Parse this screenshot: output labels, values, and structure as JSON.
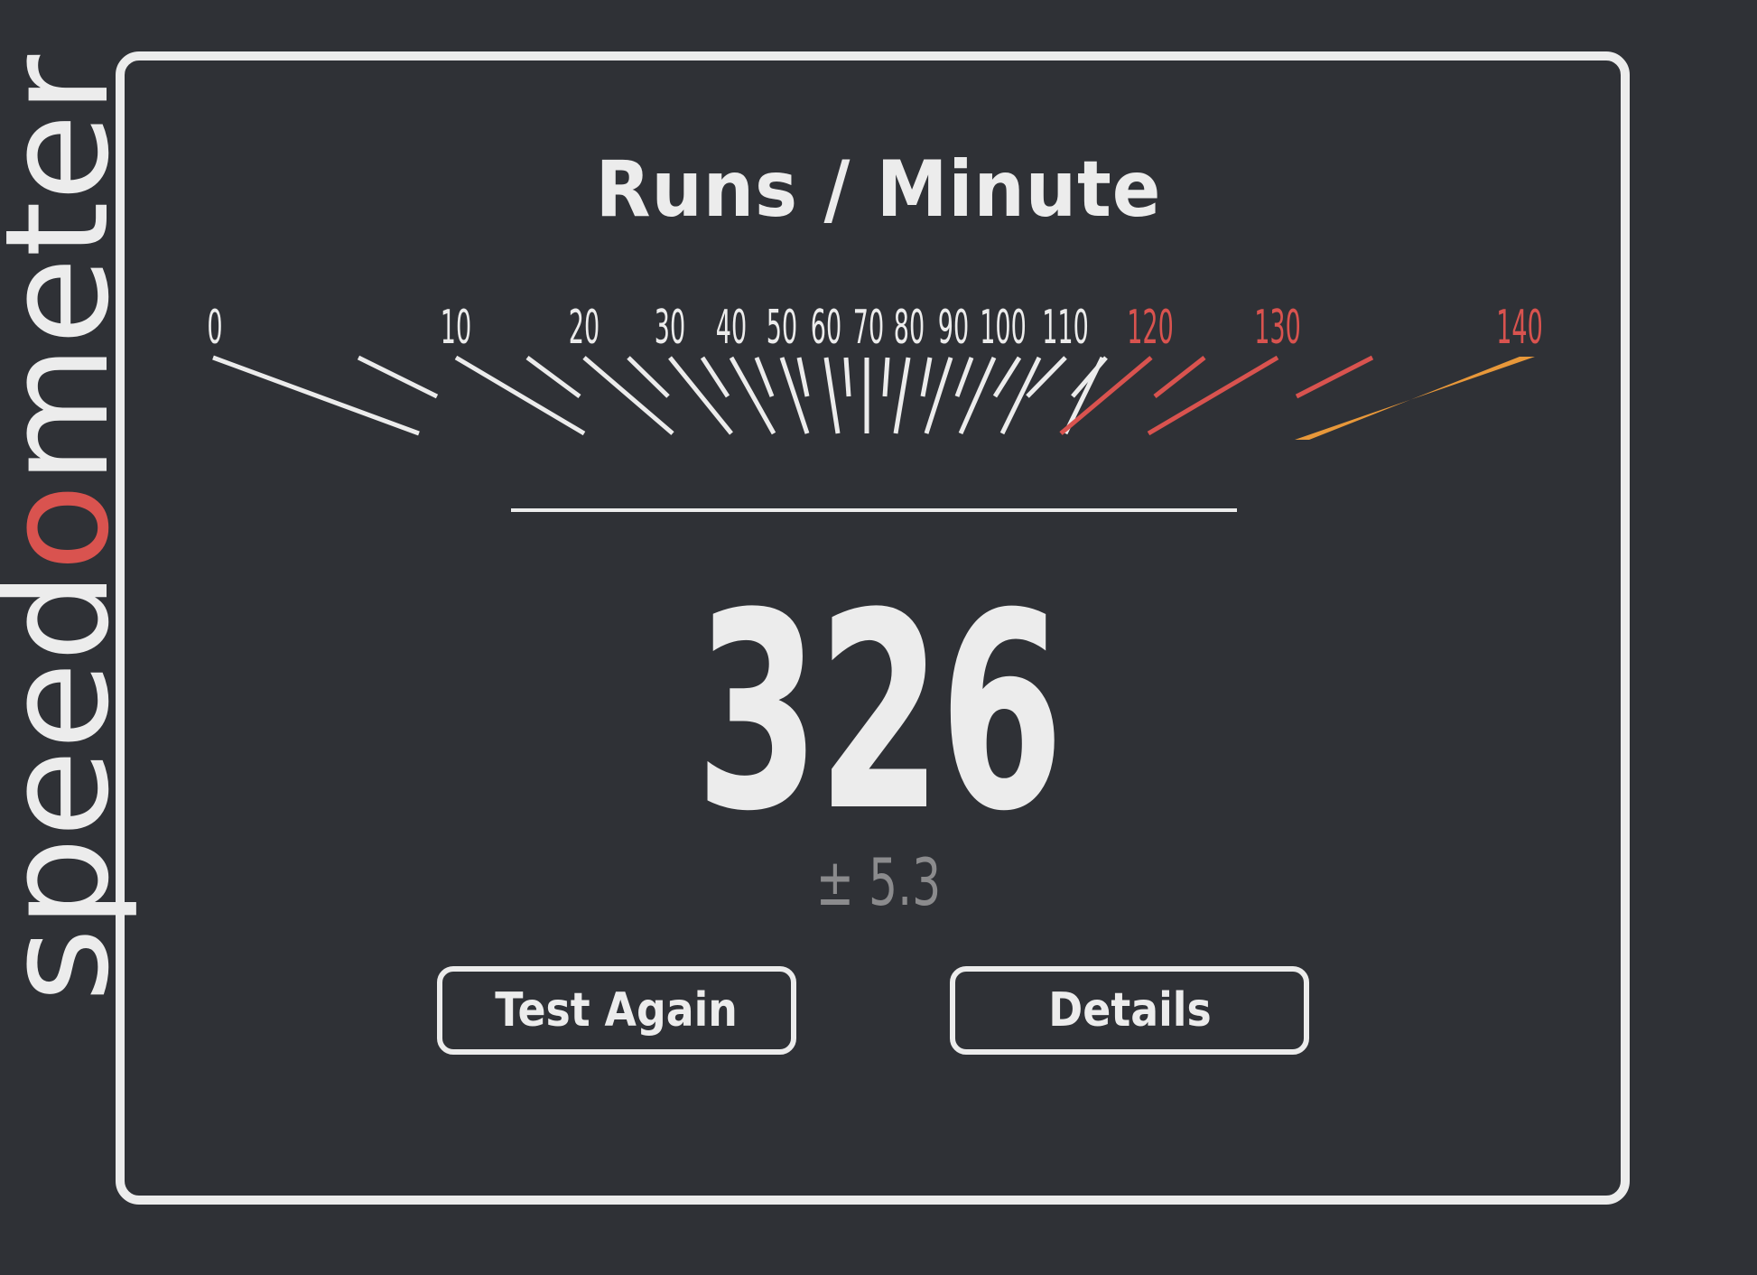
{
  "logo": {
    "text_before": "speed",
    "text_accent": "o",
    "text_after": "meter",
    "accent_color": "#d9534f"
  },
  "title": "Runs / Minute",
  "gauge": {
    "labels": [
      "0",
      "10",
      "20",
      "30",
      "40",
      "50",
      "60",
      "70",
      "80",
      "90",
      "100",
      "110",
      "120",
      "130",
      "140"
    ],
    "colors": {
      "normal": "#ececec",
      "warning": "#d9534f",
      "limit": "#e8983a"
    }
  },
  "result": {
    "score": "326",
    "error": "± 5.3"
  },
  "buttons": {
    "test_again": "Test Again",
    "details": "Details"
  }
}
